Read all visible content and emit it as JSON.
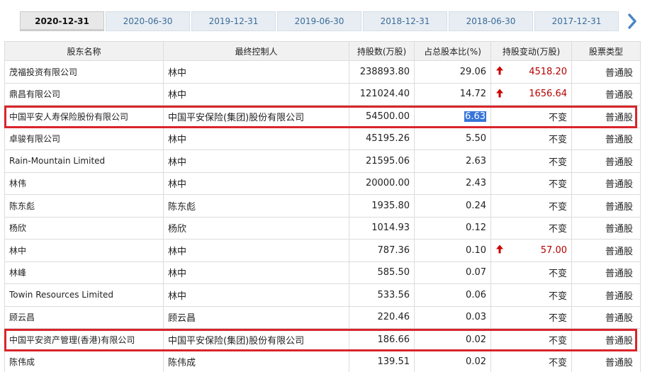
{
  "tabs": [
    {
      "label": "2020-12-31",
      "active": true
    },
    {
      "label": "2020-06-30"
    },
    {
      "label": "2019-12-31"
    },
    {
      "label": "2019-06-30"
    },
    {
      "label": "2018-12-31"
    },
    {
      "label": "2018-06-30"
    },
    {
      "label": "2017-12-31"
    }
  ],
  "next_icon": "chevron-right-icon",
  "table": {
    "headers": [
      "股东名称",
      "最终控制人",
      "持股数(万股)",
      "占总股本比(%)",
      "持股变动(万股)",
      "股票类型"
    ],
    "rows": [
      {
        "name": "茂福投资有限公司",
        "controller": "林中",
        "shares": "238893.80",
        "ratio": "29.06",
        "change": "4518.20",
        "change_dir": "up",
        "type": "普通股"
      },
      {
        "name": "鼎昌有限公司",
        "controller": "林中",
        "shares": "121024.40",
        "ratio": "14.72",
        "change": "1656.64",
        "change_dir": "up",
        "type": "普通股"
      },
      {
        "name": "中国平安人寿保险股份有限公司",
        "controller": "中国平安保险(集团)股份有限公司",
        "shares": "54500.00",
        "ratio": "6.63",
        "ratio_selected": true,
        "change": "不变",
        "type": "普通股",
        "highlighted": true
      },
      {
        "name": "卓骏有限公司",
        "controller": "林中",
        "shares": "45195.26",
        "ratio": "5.50",
        "change": "不变",
        "type": "普通股"
      },
      {
        "name": "Rain-Mountain Limited",
        "controller": "林中",
        "shares": "21595.06",
        "ratio": "2.63",
        "change": "不变",
        "type": "普通股"
      },
      {
        "name": "林伟",
        "controller": "林中",
        "shares": "20000.00",
        "ratio": "2.43",
        "change": "不变",
        "type": "普通股"
      },
      {
        "name": "陈东彪",
        "controller": "陈东彪",
        "shares": "1935.80",
        "ratio": "0.24",
        "change": "不变",
        "type": "普通股"
      },
      {
        "name": "杨欣",
        "controller": "杨欣",
        "shares": "1014.93",
        "ratio": "0.12",
        "change": "不变",
        "type": "普通股"
      },
      {
        "name": "林中",
        "controller": "林中",
        "shares": "787.36",
        "ratio": "0.10",
        "change": "57.00",
        "change_dir": "up",
        "type": "普通股"
      },
      {
        "name": "林峰",
        "controller": "林中",
        "shares": "585.50",
        "ratio": "0.07",
        "change": "不变",
        "type": "普通股"
      },
      {
        "name": "Towin Resources Limited",
        "controller": "林中",
        "shares": "533.56",
        "ratio": "0.06",
        "change": "不变",
        "type": "普通股"
      },
      {
        "name": "顾云昌",
        "controller": "顾云昌",
        "shares": "220.46",
        "ratio": "0.03",
        "change": "不变",
        "type": "普通股"
      },
      {
        "name": "中国平安资产管理(香港)有限公司",
        "controller": "中国平安保险(集团)股份有限公司",
        "shares": "186.66",
        "ratio": "0.02",
        "change": "不变",
        "type": "普通股",
        "highlighted": true
      },
      {
        "name": "陈伟成",
        "controller": "陈伟成",
        "shares": "139.51",
        "ratio": "0.02",
        "change": "不变",
        "type": "普通股"
      }
    ]
  },
  "colors": {
    "highlight_border": "#d9252b",
    "rise_text": "#b40000",
    "selection": "#3875d7"
  }
}
